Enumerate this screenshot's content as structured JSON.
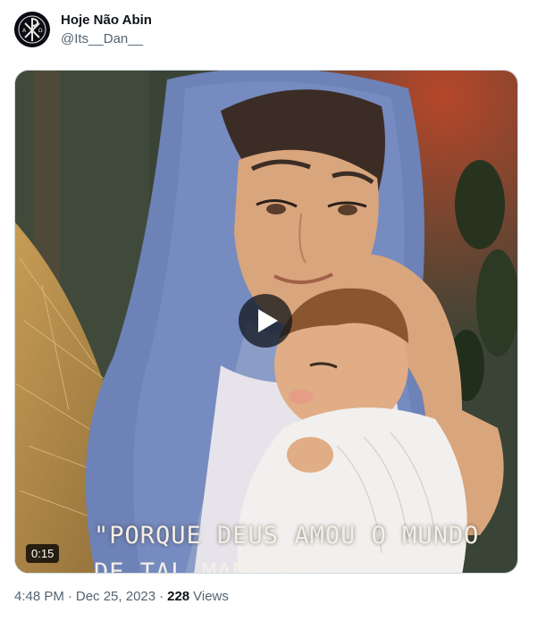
{
  "author": {
    "display_name": "Hoje Não Abin",
    "handle": "@Its__Dan__",
    "avatar_icon": "chi-rho-icon"
  },
  "media": {
    "duration": "0:15",
    "caption_line1": "\"PORQUE DEUS AMOU O MUNDO",
    "caption_line2": "DE TAL MANEIRA",
    "play_icon": "play-icon"
  },
  "meta": {
    "time": "4:48 PM",
    "separator": "·",
    "date": "Dec 25, 2023",
    "views_count": "228",
    "views_label": "Views"
  },
  "colors": {
    "text_primary": "#0f1419",
    "text_secondary": "#536471",
    "veil_blue": "#6d82b6",
    "skin": "#d9a57d",
    "background_dark": "#2f3a2e"
  }
}
